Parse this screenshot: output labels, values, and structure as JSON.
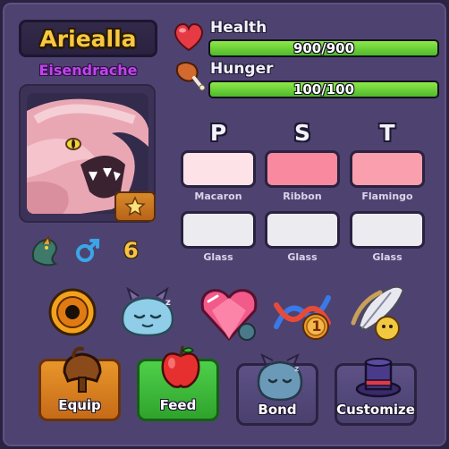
{
  "pet": {
    "name": "Ariealla",
    "species": "Eisendrache",
    "age": "6"
  },
  "stats": {
    "health": {
      "label": "Health",
      "value": 900,
      "max": 900,
      "text": "900/900"
    },
    "hunger": {
      "label": "Hunger",
      "value": 100,
      "max": 100,
      "text": "100/100"
    }
  },
  "colors": {
    "headers": [
      "P",
      "S",
      "T"
    ],
    "row1": [
      {
        "label": "Macaron",
        "hex": "#fde2e8"
      },
      {
        "label": "Ribbon",
        "hex": "#f9899f"
      },
      {
        "label": "Flamingo",
        "hex": "#fa9fad"
      }
    ],
    "row2": [
      {
        "label": "Glass",
        "hex": "#ececf0"
      },
      {
        "label": "Glass",
        "hex": "#ececf0"
      },
      {
        "label": "Glass",
        "hex": "#ececf0"
      }
    ]
  },
  "items": [
    {
      "icon": "amber-orb-icon"
    },
    {
      "icon": "sleeping-pet-icon"
    },
    {
      "icon": "heart-gem-icon"
    },
    {
      "icon": "dna-icon",
      "badge": "1"
    },
    {
      "icon": "feather-quill-icon"
    }
  ],
  "actions": {
    "equip": "Equip",
    "feed": "Feed",
    "bond": "Bond",
    "customize": "Customize"
  }
}
